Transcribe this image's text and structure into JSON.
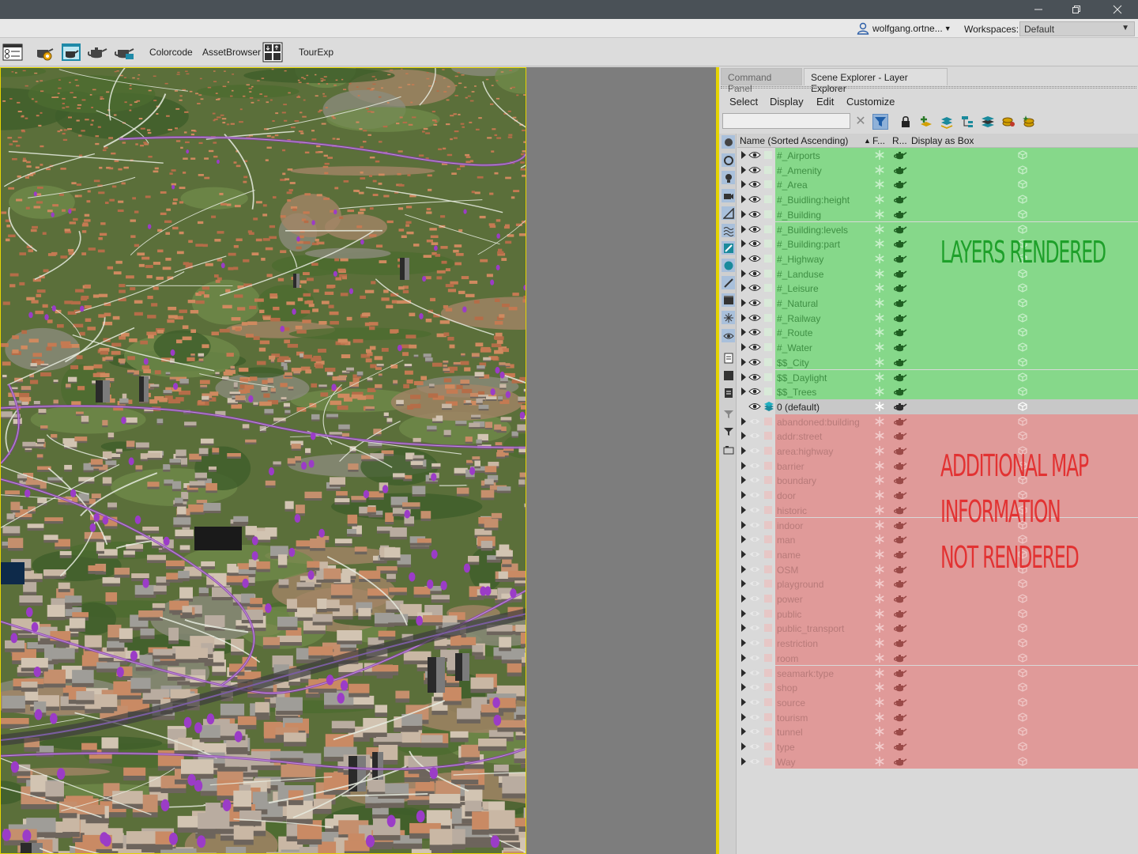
{
  "window": {
    "user": "wolfgang.ortne...",
    "workspaces_label": "Workspaces:",
    "workspace_value": "Default"
  },
  "toolbar": {
    "colorcode": "Colorcode",
    "asset_browser": "AssetBrowser",
    "tour_exp": "TourExp"
  },
  "panel": {
    "tabs": [
      "Command Panel",
      "Scene Explorer - Layer Explorer"
    ],
    "menu": [
      "Select",
      "Display",
      "Edit",
      "Customize"
    ],
    "search_value": "",
    "columns": {
      "name": "Name (Sorted Ascending)",
      "sort_indicator": "▲",
      "freeze": "F...",
      "render": "R...",
      "display_as_box": "Display as Box"
    },
    "rendered_layers": [
      "#_Airports",
      "#_Amenity",
      "#_Area",
      "#_Buidling:height",
      "#_Building",
      "#_Building:levels",
      "#_Building:part",
      "#_Highway",
      "#_Landuse",
      "#_Leisure",
      "#_Natural",
      "#_Railway",
      "#_Route",
      "#_Water",
      "$$_City",
      "$$_Daylight",
      "$$_Trees"
    ],
    "default_layer": "0 (default)",
    "hidden_layers": [
      "abandoned:building",
      "addr:street",
      "area:highway",
      "barrier",
      "boundary",
      "door",
      "historic",
      "indoor",
      "man",
      "name",
      "OSM",
      "playground",
      "power",
      "public",
      "public_transport",
      "restriction",
      "room",
      "seamark:type",
      "shop",
      "source",
      "tourism",
      "tunnel",
      "type",
      "Way"
    ]
  },
  "annotations": {
    "rendered": "LAYERS RENDERED",
    "not_rendered": [
      "ADDITIONAL MAP",
      "INFORMATION",
      "NOT RENDERED"
    ]
  },
  "colors": {
    "rendered_row": "#86d88a",
    "hidden_row": "#e09a99",
    "rendered_annotation": "#1ea02a",
    "hidden_annotation": "#e23232",
    "viewport_border": "#e6d400"
  }
}
